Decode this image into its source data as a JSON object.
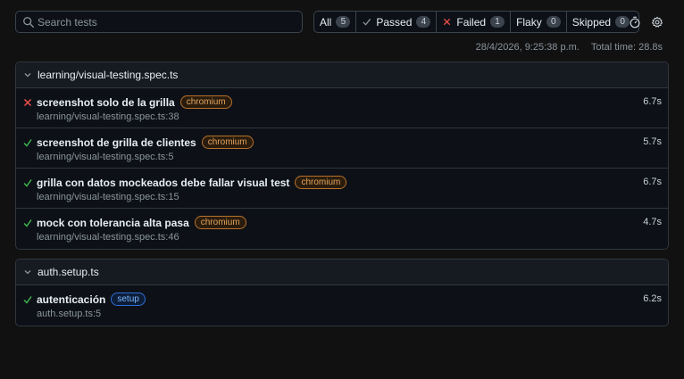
{
  "search": {
    "placeholder": "Search tests",
    "value": ""
  },
  "filters": [
    {
      "label": "All",
      "count": "5",
      "icon": ""
    },
    {
      "label": "Passed",
      "count": "4",
      "icon": "check-icon"
    },
    {
      "label": "Failed",
      "count": "1",
      "icon": "cross-icon"
    },
    {
      "label": "Flaky",
      "count": "0",
      "icon": ""
    },
    {
      "label": "Skipped",
      "count": "0",
      "icon": ""
    }
  ],
  "toolbar_icons": [
    "stopwatch-icon",
    "gear-icon"
  ],
  "meta": {
    "date": "28/4/2026, 9:25:38 p.m.",
    "total_time": "Total time: 28.8s"
  },
  "colors": {
    "passed": "#3fb950",
    "failed": "#f85149",
    "chromium": "#e3a45c",
    "setup": "#79b8ff"
  },
  "files": [
    {
      "name": "learning/visual-testing.spec.ts",
      "tests": [
        {
          "status": "failed",
          "title": "screenshot solo de la grilla",
          "tag": "chromium",
          "location": "learning/visual-testing.spec.ts:38",
          "duration": "6.7s"
        },
        {
          "status": "passed",
          "title": "screenshot de grilla de clientes",
          "tag": "chromium",
          "location": "learning/visual-testing.spec.ts:5",
          "duration": "5.7s"
        },
        {
          "status": "passed",
          "title": "grilla con datos mockeados debe fallar visual test",
          "tag": "chromium",
          "location": "learning/visual-testing.spec.ts:15",
          "duration": "6.7s"
        },
        {
          "status": "passed",
          "title": "mock con tolerancia alta pasa",
          "tag": "chromium",
          "location": "learning/visual-testing.spec.ts:46",
          "duration": "4.7s"
        }
      ]
    },
    {
      "name": "auth.setup.ts",
      "tests": [
        {
          "status": "passed",
          "title": "autenticación",
          "tag": "setup",
          "location": "auth.setup.ts:5",
          "duration": "6.2s"
        }
      ]
    }
  ]
}
